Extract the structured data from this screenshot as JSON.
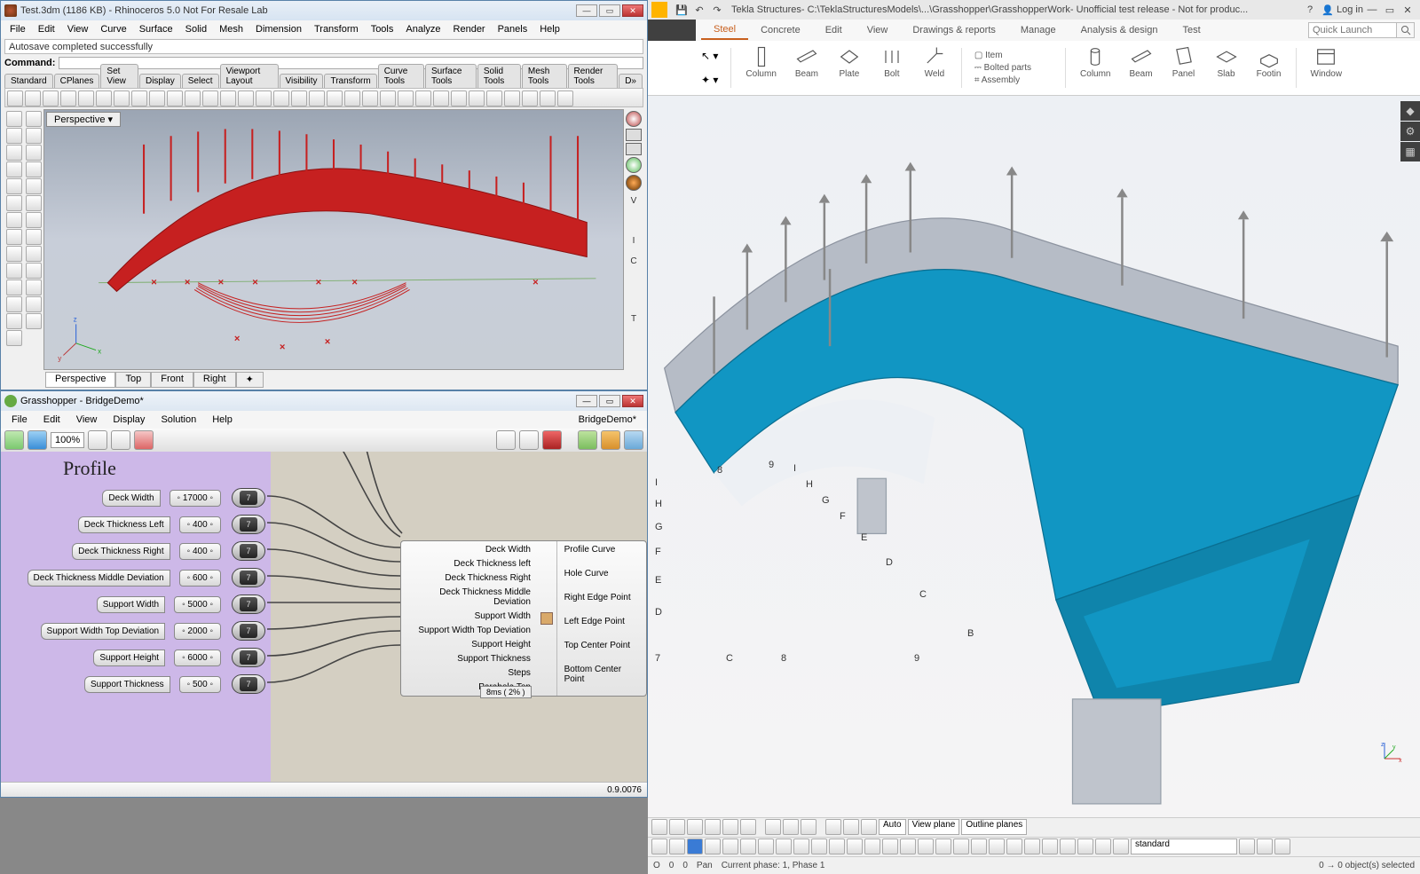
{
  "rhino": {
    "title": "Test.3dm (1186 KB) - Rhinoceros 5.0 Not For Resale Lab",
    "menu": [
      "File",
      "Edit",
      "View",
      "Curve",
      "Surface",
      "Solid",
      "Mesh",
      "Dimension",
      "Transform",
      "Tools",
      "Analyze",
      "Render",
      "Panels",
      "Help"
    ],
    "cmd_echo": "Autosave completed successfully",
    "cmd_label": "Command:",
    "tabs": [
      "Standard",
      "CPlanes",
      "Set View",
      "Display",
      "Select",
      "Viewport Layout",
      "Visibility",
      "Transform",
      "Curve Tools",
      "Surface Tools",
      "Solid Tools",
      "Mesh Tools",
      "Render Tools",
      "D»"
    ],
    "viewport_label": "Perspective",
    "view_tabs": [
      "Perspective",
      "Top",
      "Front",
      "Right"
    ],
    "side_letters": [
      "V",
      "I",
      "C",
      "T"
    ]
  },
  "grasshopper": {
    "title": "Grasshopper - BridgeDemo*",
    "menu": [
      "File",
      "Edit",
      "View",
      "Display",
      "Solution",
      "Help"
    ],
    "doc_name": "BridgeDemo*",
    "zoom": "100%",
    "profile_heading": "Profile",
    "params": [
      {
        "label": "Deck Width",
        "value": "◦ 17000 ◦"
      },
      {
        "label": "Deck Thickness Left",
        "value": "◦ 400 ◦"
      },
      {
        "label": "Deck Thickness Right",
        "value": "◦ 400 ◦"
      },
      {
        "label": "Deck Thickness Middle Deviation",
        "value": "◦ 600 ◦"
      },
      {
        "label": "Support Width",
        "value": "◦ 5000 ◦"
      },
      {
        "label": "Support Width Top Deviation",
        "value": "◦ 2000 ◦"
      },
      {
        "label": "Support Height",
        "value": "◦ 6000 ◦"
      },
      {
        "label": "Support Thickness",
        "value": "◦ 500 ◦"
      }
    ],
    "cluster_left": [
      "Deck Width",
      "Deck Thickness left",
      "Deck Thickness Right",
      "Deck Thickness Middle Deviation",
      "Support Width",
      "Support Width Top Deviation",
      "Support Height",
      "Support Thickness",
      "Steps",
      "Parabola Top"
    ],
    "cluster_right": [
      "Profile Curve",
      "Hole Curve",
      "Right Edge Point",
      "Left Edge Point",
      "Top Center Point",
      "Bottom Center Point"
    ],
    "cluster_footer": "8ms ( 2% )",
    "status_version": "0.9.0076"
  },
  "tekla": {
    "title_parts": [
      "Tekla Structures",
      " - C:\\TeklaStructuresModels\\...\\Grasshopper\\GrasshopperWork",
      " - Unofficial test release - Not for produc..."
    ],
    "login_label": "Log in",
    "ribbon_tabs": [
      "Steel",
      "Concrete",
      "Edit",
      "View",
      "Drawings & reports",
      "Manage",
      "Analysis & design",
      "Test"
    ],
    "ribbon_active": "Steel",
    "quicklaunch_placeholder": "Quick Launch",
    "tool_arrow_dropdown": "▾",
    "tool_magic_dropdown": "▾",
    "groups_steel": [
      {
        "name": "Column"
      },
      {
        "name": "Beam"
      },
      {
        "name": "Plate"
      },
      {
        "name": "Bolt"
      },
      {
        "name": "Weld"
      }
    ],
    "list_items": [
      "Item",
      "Bolted parts",
      "Assembly"
    ],
    "groups_conc": [
      {
        "name": "Column"
      },
      {
        "name": "Beam"
      },
      {
        "name": "Panel"
      },
      {
        "name": "Slab"
      },
      {
        "name": "Footin"
      },
      {
        "name": "Window"
      }
    ],
    "view_combo1": "Auto",
    "view_combo2": "View plane",
    "view_combo3": "Outline planes",
    "filter_combo": "standard",
    "status": {
      "o_label": "O",
      "o_x": "0",
      "o_y": "0",
      "pan": "Pan",
      "phase": "Current phase: 1, Phase 1",
      "sel": "0 → 0 object(s) selected"
    },
    "grid": {
      "numbers_top": [
        "8",
        "9"
      ],
      "numbers_bot": [
        "7",
        "8",
        "9"
      ],
      "letter_row": [
        "I",
        "H",
        "G",
        "F",
        "E",
        "D",
        "C",
        "B"
      ],
      "letter_col": [
        "I",
        "H",
        "G",
        "F",
        "E",
        "D",
        "7"
      ]
    }
  }
}
